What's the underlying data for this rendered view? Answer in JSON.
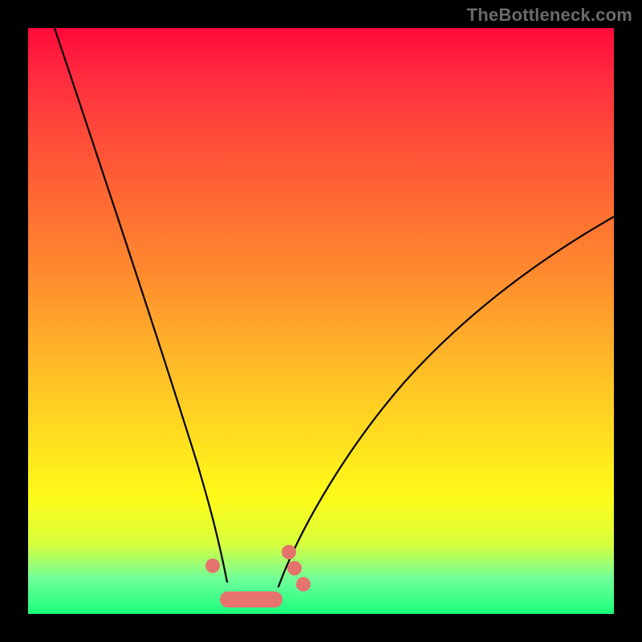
{
  "watermark": "TheBottleneck.com",
  "chart_data": {
    "type": "line",
    "title": "",
    "xlabel": "",
    "ylabel": "",
    "xlim": [
      0,
      100
    ],
    "ylim": [
      0,
      100
    ],
    "series": [
      {
        "name": "left-branch",
        "x": [
          4.5,
          8,
          12,
          16,
          20,
          23,
          26,
          28,
          30,
          31.5,
          33
        ],
        "y": [
          100,
          85,
          68,
          52,
          37,
          26,
          17,
          11,
          7,
          5,
          4
        ]
      },
      {
        "name": "right-branch",
        "x": [
          43,
          46,
          50,
          56,
          63,
          72,
          82,
          92,
          100
        ],
        "y": [
          5,
          9,
          15,
          23,
          32,
          42,
          52,
          61,
          68
        ]
      }
    ],
    "markers": [
      {
        "x": 31.5,
        "y": 8
      },
      {
        "x": 44.5,
        "y": 11
      },
      {
        "x": 45.5,
        "y": 8
      },
      {
        "x": 47.0,
        "y": 5
      }
    ],
    "flat_segment": {
      "x_start": 33,
      "x_end": 43,
      "y": 2.5
    },
    "colors": {
      "curve": "#000000",
      "marker": "#e6736e",
      "background_top": "#ff0a3a",
      "background_bottom": "#1aff7a"
    }
  }
}
